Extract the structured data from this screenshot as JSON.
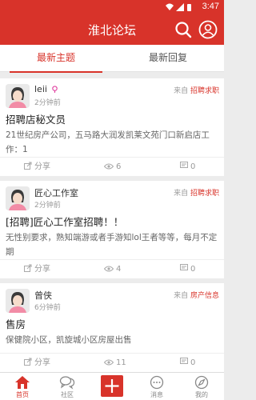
{
  "status_bar": {
    "time": "3:47"
  },
  "header": {
    "title": "淮北论坛"
  },
  "tabs": [
    {
      "label": "最新主题",
      "active": true
    },
    {
      "label": "最新回复",
      "active": false
    }
  ],
  "posts": [
    {
      "username": "leii",
      "gender": "female",
      "time": "2分钟前",
      "source_prefix": "来自",
      "forum": "招聘求职",
      "title": "招聘店秘文员",
      "excerpt": "21世纪房产公司，五马路大润发凯莱文苑门口新启店工作：1",
      "share_label": "分享",
      "views": "6",
      "comments": "0"
    },
    {
      "username": "匠心工作室",
      "gender": "",
      "time": "2分钟前",
      "source_prefix": "来自",
      "forum": "招聘求职",
      "title": "[招聘]匠心工作室招聘！！",
      "excerpt": "无性别要求，熟知端游或者手游知lol王者等等，每月不定期",
      "share_label": "分享",
      "views": "4",
      "comments": "0"
    },
    {
      "username": "曾侠",
      "gender": "",
      "time": "6分钟前",
      "source_prefix": "来自",
      "forum": "房产信息",
      "title": "售房",
      "excerpt": "保健院小区，凯旋城小区房屋出售",
      "share_label": "分享",
      "views": "11",
      "comments": "0"
    }
  ],
  "bottom_nav": [
    {
      "label": "首页",
      "icon": "home-icon",
      "active": true
    },
    {
      "label": "社区",
      "icon": "community-icon",
      "active": false
    },
    {
      "label": "",
      "icon": "plus-icon",
      "active": false
    },
    {
      "label": "消息",
      "icon": "message-icon",
      "active": false
    },
    {
      "label": "我的",
      "icon": "compass-icon",
      "active": false
    }
  ],
  "colors": {
    "brand": "#d8332a",
    "gender_female": "#e040a0"
  }
}
